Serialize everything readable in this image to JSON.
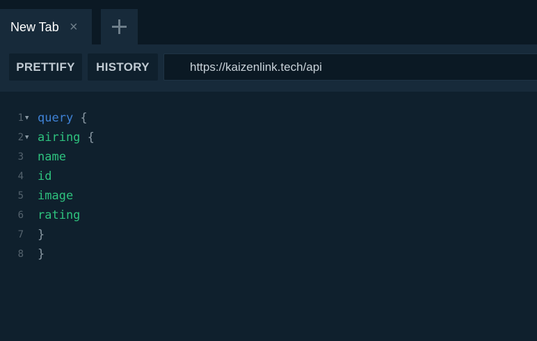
{
  "tabs": [
    {
      "label": "New Tab"
    }
  ],
  "icons": {
    "tab_close": "close-icon",
    "new_tab": "plus-icon",
    "fold": "fold-arrow-icon"
  },
  "toolbar": {
    "prettify_label": "PRETTIFY",
    "history_label": "HISTORY",
    "url_value": "https://kaizenlink.tech/api"
  },
  "editor": {
    "lines": [
      {
        "num": "1",
        "text": "query",
        "suffix": " {",
        "kind": "keyword",
        "foldable": true
      },
      {
        "num": "2",
        "text": "airing",
        "suffix": " {",
        "kind": "field",
        "foldable": true
      },
      {
        "num": "3",
        "text": "name",
        "suffix": "",
        "kind": "field",
        "foldable": false
      },
      {
        "num": "4",
        "text": "id",
        "suffix": "",
        "kind": "field",
        "foldable": false
      },
      {
        "num": "5",
        "text": "image",
        "suffix": "",
        "kind": "field",
        "foldable": false
      },
      {
        "num": "6",
        "text": "rating",
        "suffix": "",
        "kind": "field",
        "foldable": false
      },
      {
        "num": "7",
        "text": "}",
        "suffix": "",
        "kind": "punct",
        "foldable": false
      },
      {
        "num": "8",
        "text": "}",
        "suffix": "",
        "kind": "punct",
        "foldable": false
      }
    ]
  },
  "colors": {
    "background": "#0f202d",
    "tabbar": "#0b1924",
    "panel": "#172a3a",
    "keyword": "#3f82d6",
    "field": "#2ec27e",
    "punctuation": "#8a99a4"
  }
}
